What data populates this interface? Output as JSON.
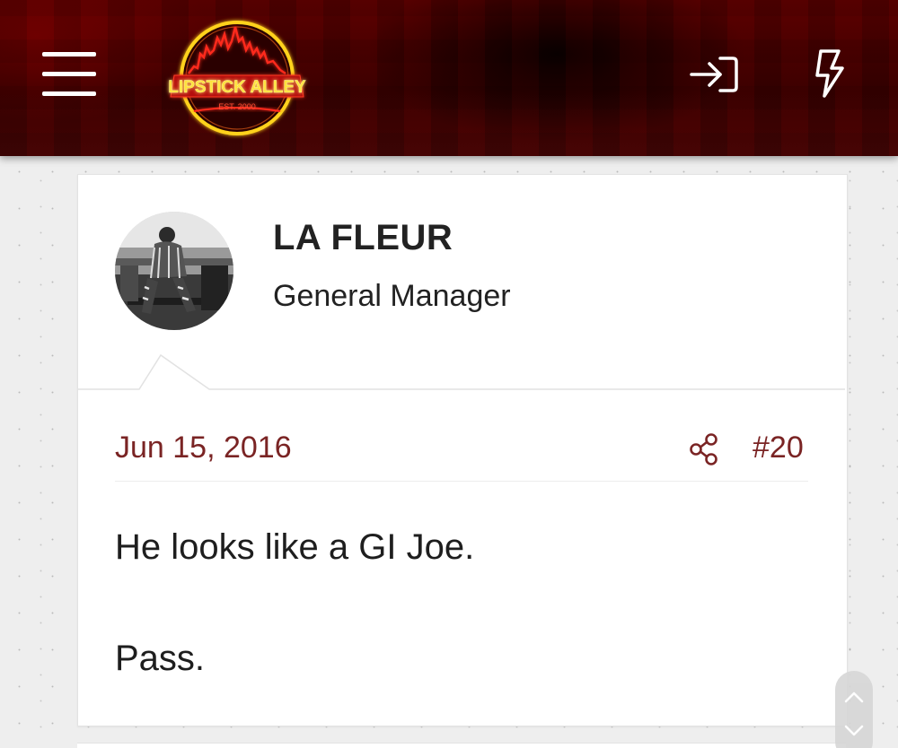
{
  "header": {
    "logo": {
      "main_text": "LIPSTICK ALLEY",
      "sub_text": "EST. 2000"
    },
    "icons": {
      "menu": "hamburger-menu-icon",
      "login": "login-icon",
      "whats_new": "lightning-bolt-icon"
    }
  },
  "post": {
    "author": {
      "name": "LA FLEUR",
      "title": "General Manager"
    },
    "date": "Jun 15, 2016",
    "number": "#20",
    "body": [
      "He looks like a GI Joe.",
      "Pass."
    ]
  },
  "colors": {
    "header_red": "#4a0000",
    "accent_link": "#7a2424",
    "page_bg": "#eeeeee",
    "logo_yellow": "#ffe23a",
    "logo_red": "#e8231a"
  }
}
